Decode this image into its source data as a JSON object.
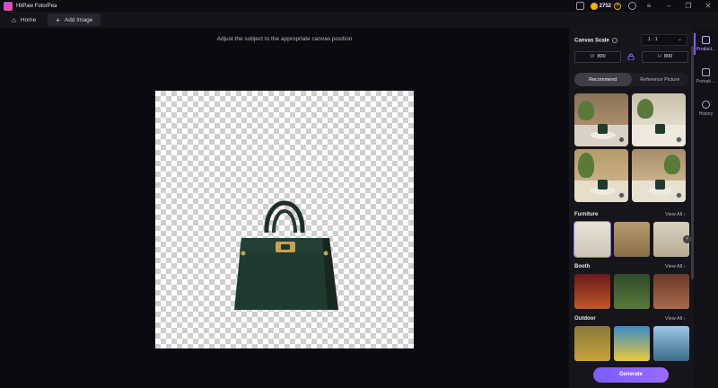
{
  "app": {
    "name": "HitPaw FotorPea",
    "coins": "2752"
  },
  "tabs": [
    {
      "label": "Home",
      "icon": "home-icon"
    },
    {
      "label": "Add Image",
      "icon": "plus-icon"
    }
  ],
  "canvas": {
    "hint": "Adjust the subject to the appropriate canvas position"
  },
  "panel": {
    "canvas_scale_label": "Canvas Scale",
    "ratio": "1 : 1",
    "width_label": "W",
    "width_value": "800",
    "height_label": "H",
    "height_value": "800",
    "segments": [
      "Recommend",
      "Reference Picture"
    ],
    "sections": [
      {
        "title": "Furniture",
        "view_all": "View All"
      },
      {
        "title": "Booth",
        "view_all": "View All"
      },
      {
        "title": "Outdoor",
        "view_all": "View All"
      }
    ],
    "generate_label": "Generate"
  },
  "rail": [
    {
      "label": "Product...",
      "icon": "bag-icon"
    },
    {
      "label": "Portrait ...",
      "icon": "portrait-icon"
    },
    {
      "label": "History",
      "icon": "clock-icon"
    }
  ],
  "colors": {
    "accent": "#8a5cff",
    "bag": "#1f3b2f"
  }
}
